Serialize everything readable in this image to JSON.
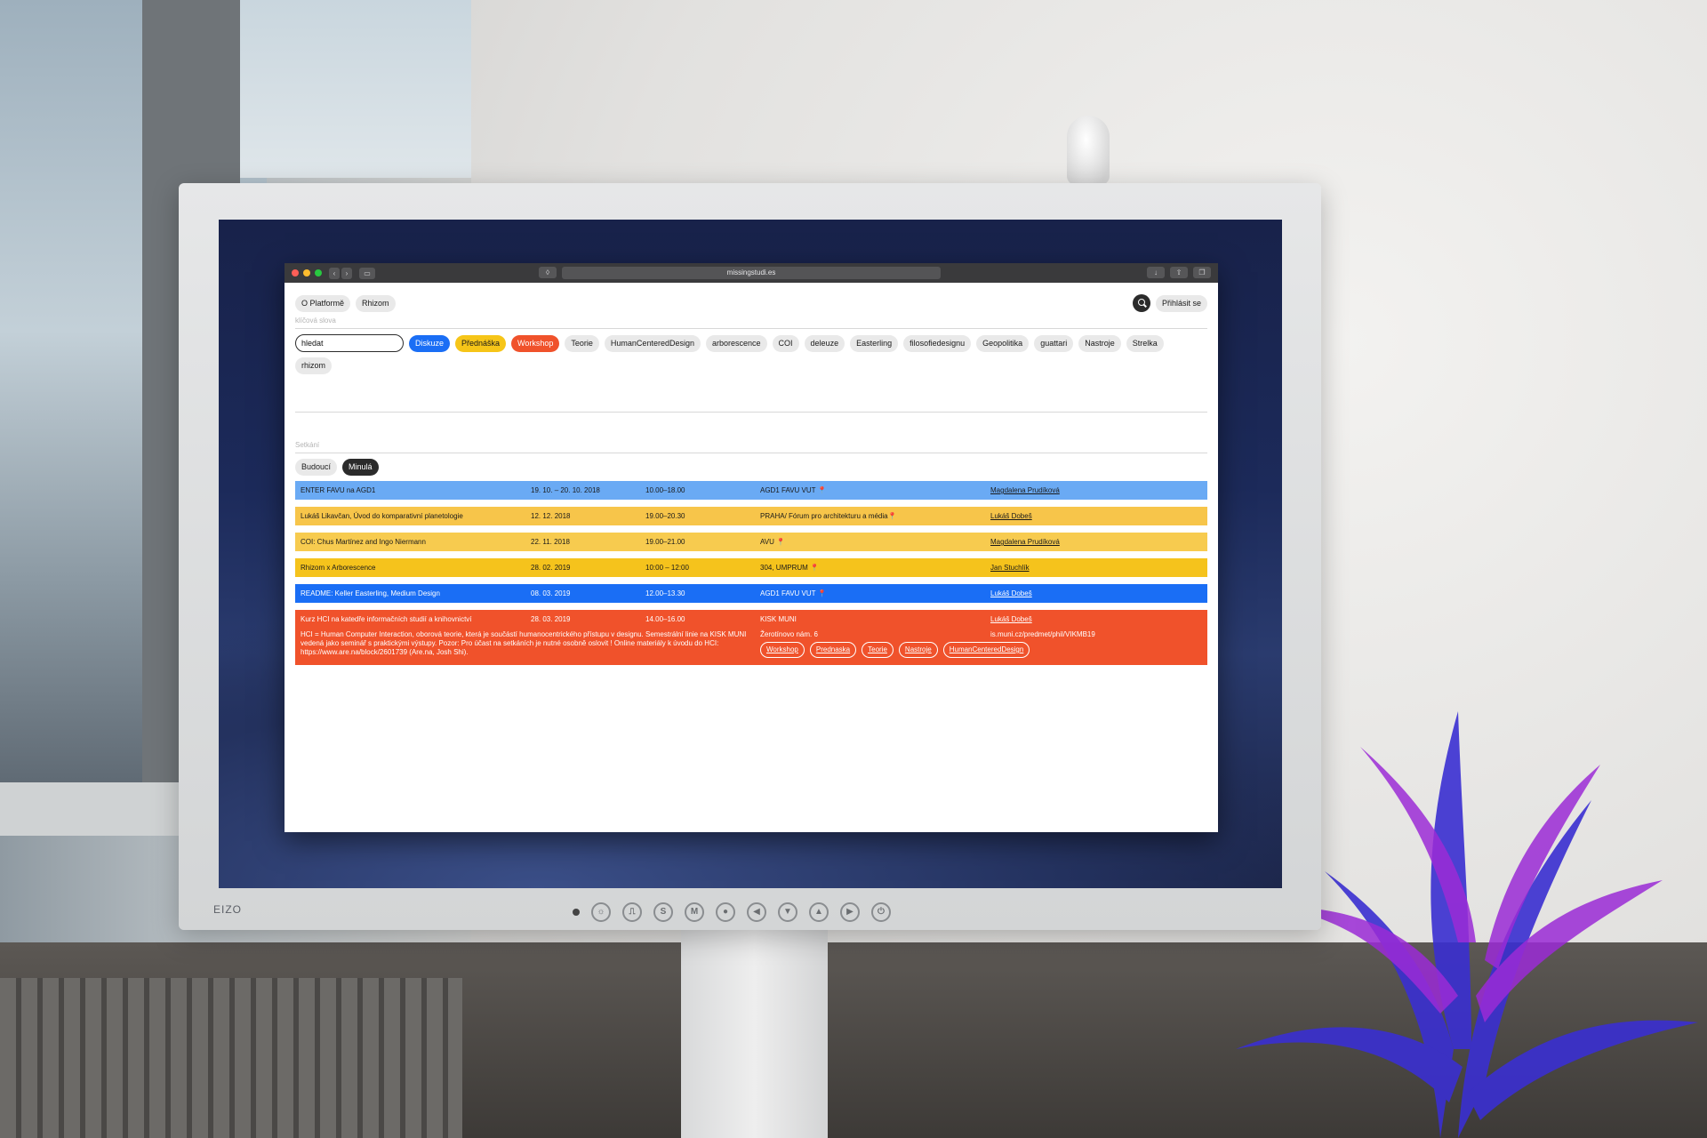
{
  "browser": {
    "url": "missingstudi.es"
  },
  "nav": {
    "about": "O Platformě",
    "rhizom": "Rhizom",
    "login": "Přihlásit se"
  },
  "keywords": {
    "label": "klíčová slova",
    "search_value": "hledat",
    "tags": [
      "Diskuze",
      "Přednáška",
      "Workshop",
      "Teorie",
      "HumanCenteredDesign",
      "arborescence",
      "COI",
      "deleuze",
      "Easterling",
      "filosofiedesignu",
      "Geopolitika",
      "guattari",
      "Nastroje",
      "Strelka",
      "rhizom"
    ]
  },
  "meetings": {
    "label": "Setkání",
    "tab_future": "Budoucí",
    "tab_past": "Minulá"
  },
  "events": [
    {
      "title": "ENTER FAVU na AGD1",
      "date": "19. 10. – 20. 10. 2018",
      "time": "10.00–18.00",
      "place": "AGD1 FAVU VUT",
      "person": "Magdalena Prudíková"
    },
    {
      "title": "Lukáš Likavčan, Úvod do komparativní planetologie",
      "date": "12. 12. 2018",
      "time": "19.00–20.30",
      "place": "PRAHA/ Fórum pro architekturu a média",
      "person": "Lukáš Dobeš"
    },
    {
      "title": "COI: Chus Martínez and Ingo Niermann",
      "date": "22. 11. 2018",
      "time": "19.00–21.00",
      "place": "AVU",
      "person": "Magdalena Prudíková"
    },
    {
      "title": "Rhizom x Arborescence",
      "date": "28. 02. 2019",
      "time": "10:00 – 12:00",
      "place": "304, UMPRUM",
      "person": "Jan Stuchlík"
    },
    {
      "title": "README: Keller Easterling, Medium Design",
      "date": "08. 03. 2019",
      "time": "12.00–13.30",
      "place": "AGD1 FAVU VUT",
      "person": "Lukáš Dobeš"
    },
    {
      "title": "Kurz HCI na katedře informačních studií a knihovnictví",
      "date": "28. 03. 2019",
      "time": "14.00–16.00",
      "place": "KISK MUNI",
      "person": "Lukáš Dobeš",
      "description": "HCI = Human Computer Interaction, oborová teorie, která je součástí humanocentrického přístupu v designu. Semestrální linie na KISK MUNI vedená jako seminář s praktickými výstupy. Pozor: Pro účast na setkáních je nutné osobně oslovit ! Online materiály k úvodu do HCI: https://www.are.na/block/2601739 (Are.na, Josh Shi).",
      "address": "Žerotínovo nám. 6",
      "link": "is.muni.cz/predmet/phil/VIKMB19",
      "tags": [
        "Workshop",
        "Prednaska",
        "Teorie",
        "Nastroje",
        "HumanCenteredDesign"
      ]
    }
  ],
  "monitor": {
    "brand": "EIZO",
    "buttons": [
      "☼",
      "⎍",
      "S",
      "M",
      "●",
      "◀",
      "▼",
      "▲",
      "▶",
      "⏻"
    ]
  },
  "colors": {
    "diskuze": "#1a6ef5",
    "prednaska": "#f6c518",
    "workshop": "#f0522b"
  }
}
